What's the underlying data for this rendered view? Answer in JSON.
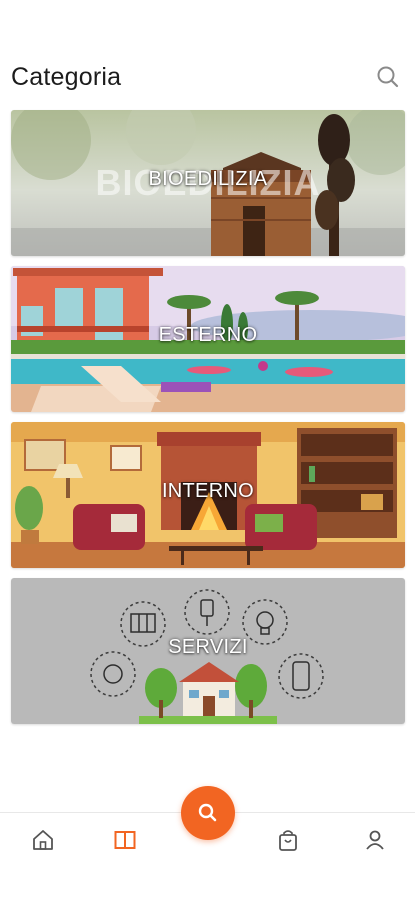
{
  "header": {
    "title": "Categoria",
    "search_icon": "search-icon"
  },
  "categories": [
    {
      "label": "BIOEDILIZIA",
      "ghost": "BIOEDILIZIA",
      "theme": "wooden-house-bokeh"
    },
    {
      "label": "ESTERNO",
      "theme": "villa-pool-palms"
    },
    {
      "label": "INTERNO",
      "theme": "living-room-fireplace"
    },
    {
      "label": "SERVIZI",
      "theme": "house-energy-icons"
    }
  ],
  "bottom_nav": {
    "items": [
      "home-icon",
      "book-icon",
      "search-icon",
      "shopping-bag-icon",
      "user-icon"
    ],
    "active": "book-icon",
    "accent_color": "#f26522"
  }
}
